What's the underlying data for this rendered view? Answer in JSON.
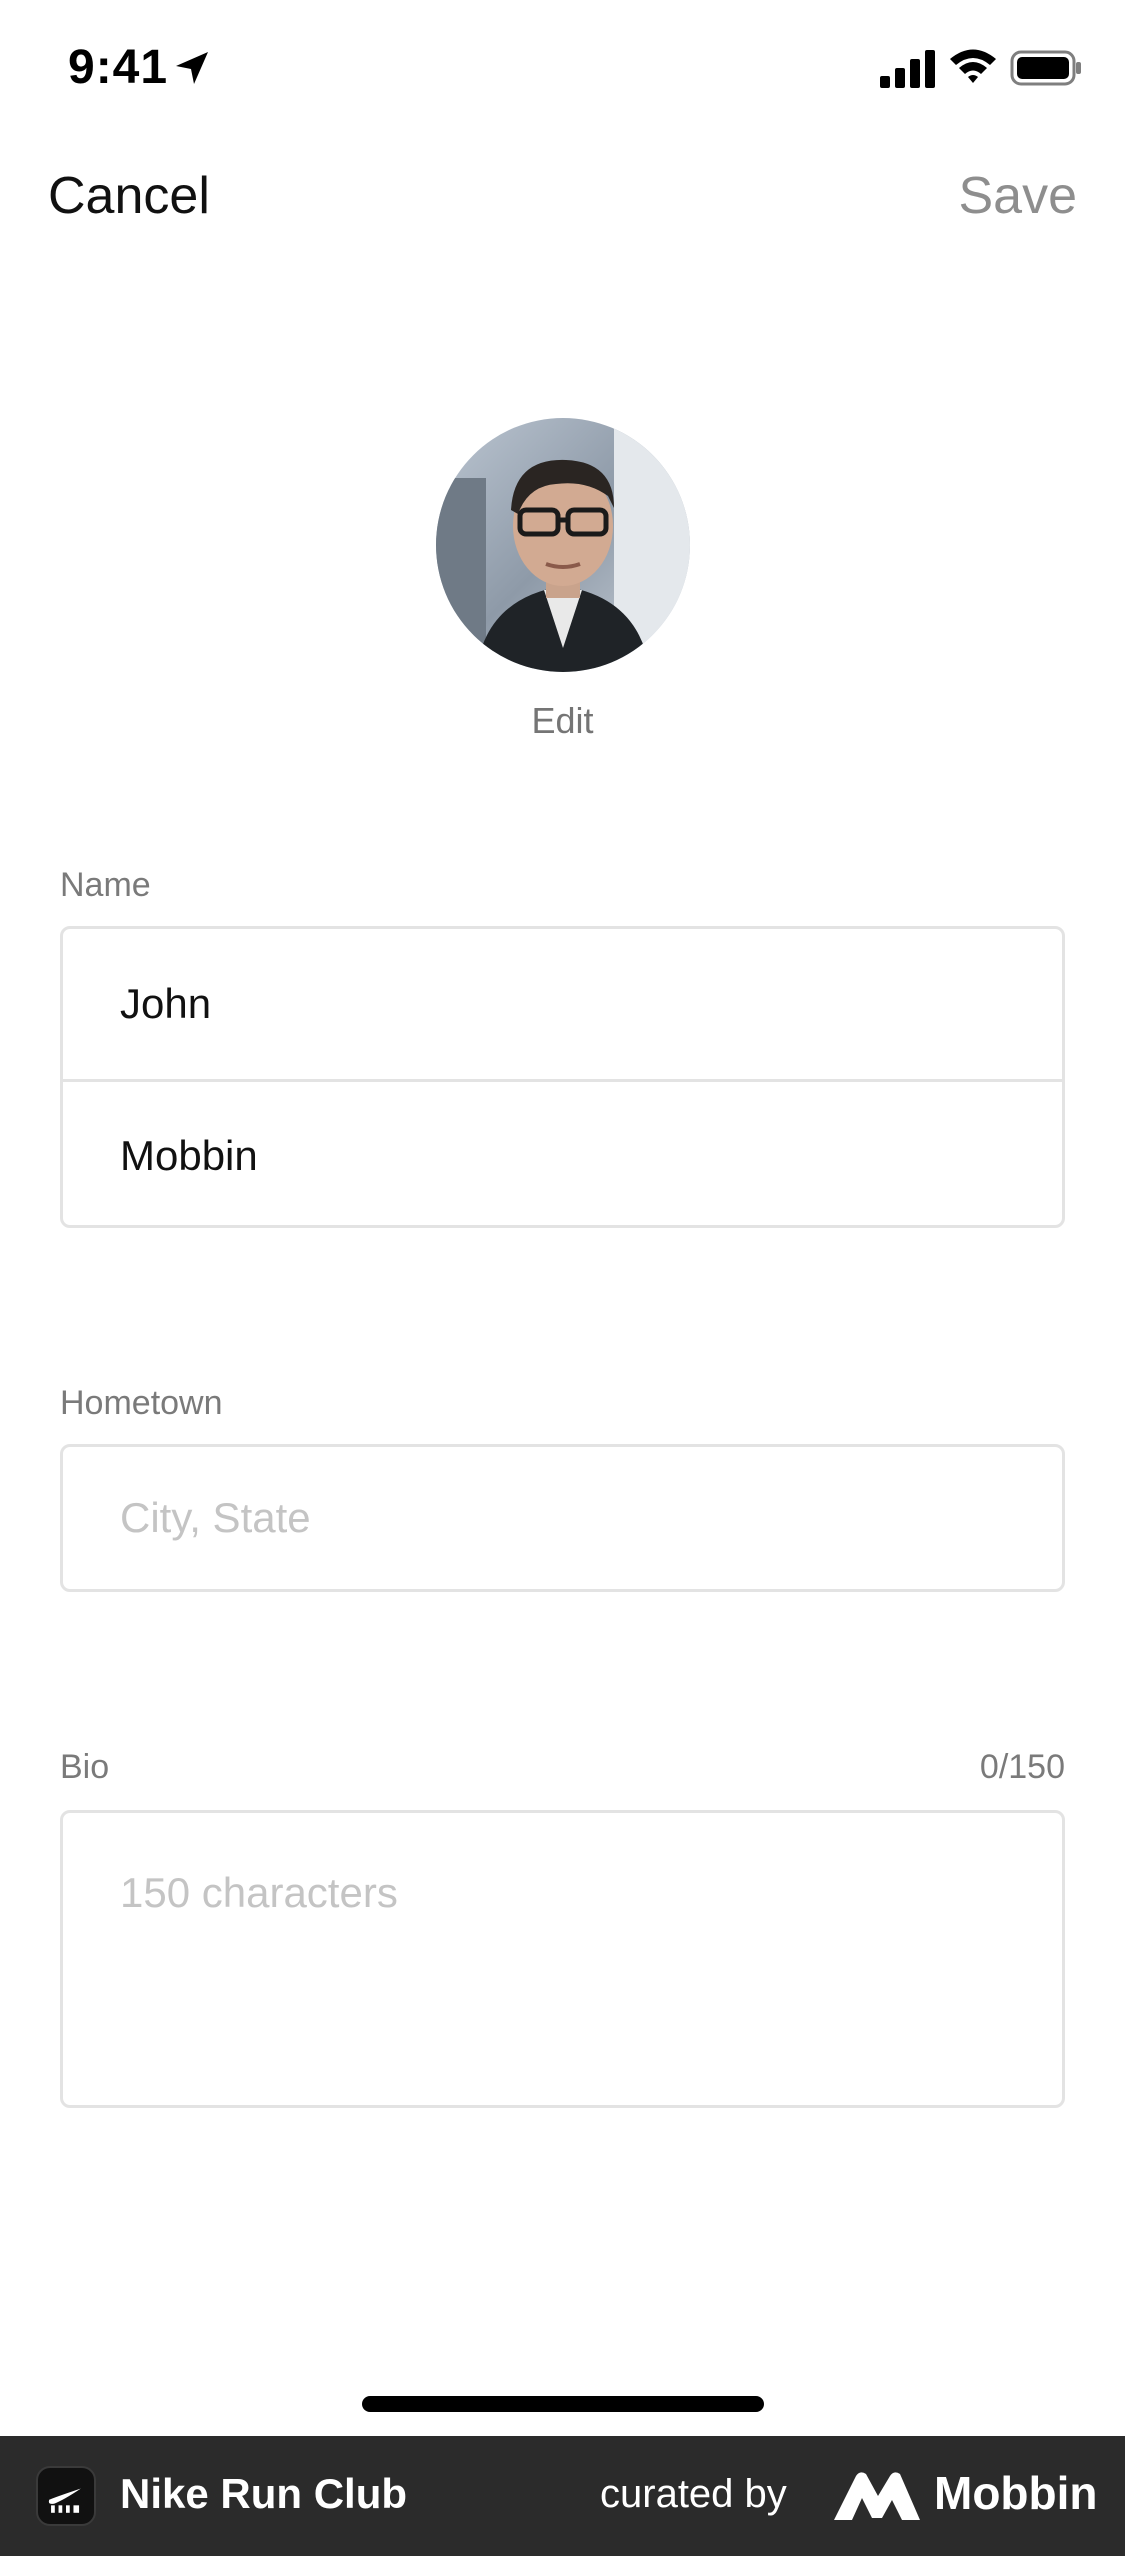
{
  "status_bar": {
    "time": "9:41"
  },
  "nav": {
    "cancel_label": "Cancel",
    "save_label": "Save"
  },
  "profile": {
    "edit_label": "Edit"
  },
  "name_section": {
    "label": "Name",
    "first_name": "John",
    "last_name": "Mobbin"
  },
  "hometown_section": {
    "label": "Hometown",
    "placeholder": "City, State"
  },
  "bio_section": {
    "label": "Bio",
    "counter": "0/150",
    "placeholder": "150 characters"
  },
  "footer": {
    "app_name": "Nike Run Club",
    "curated_by": "curated by",
    "brand": "Mobbin"
  },
  "icons": {
    "status": [
      "location-arrow-icon",
      "cellular-signal-icon",
      "wifi-icon",
      "battery-icon"
    ],
    "footer": [
      "nike-run-club-app-icon",
      "mobbin-logo-icon"
    ]
  }
}
